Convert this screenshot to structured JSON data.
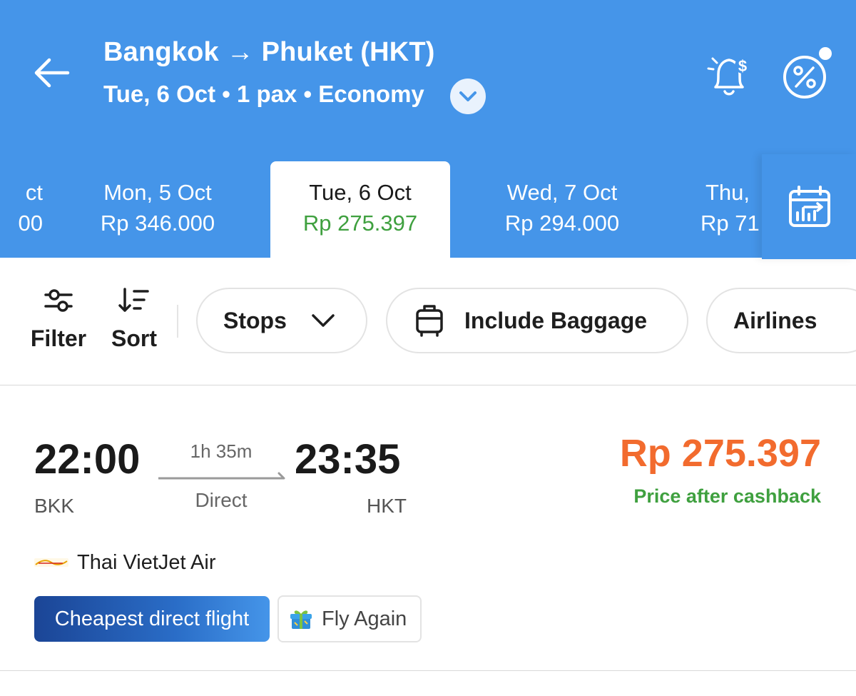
{
  "header": {
    "route_title": "Bangkok → Phuket (HKT)",
    "trip_summary": "Tue, 6 Oct • 1 pax • Economy",
    "icons": [
      "back-arrow-icon",
      "chevron-down-icon",
      "price-alert-bell-icon",
      "promo-percent-icon",
      "calendar-chart-icon"
    ]
  },
  "date_strip": {
    "partial_left": {
      "date": "ct",
      "price": "00"
    },
    "tabs": [
      {
        "date": "Mon, 5 Oct",
        "price": "Rp 346.000"
      },
      {
        "date": "Tue, 6 Oct",
        "price": "Rp 275.397",
        "selected": true
      },
      {
        "date": "Wed, 7 Oct",
        "price": "Rp 294.000"
      }
    ],
    "partial_right": {
      "date": "Thu,",
      "price": "Rp 71"
    }
  },
  "filters": {
    "filter_label": "Filter",
    "sort_label": "Sort",
    "chips": {
      "stops": "Stops",
      "baggage": "Include Baggage",
      "airlines": "Airlines"
    }
  },
  "flight": {
    "departure_time": "22:00",
    "departure_code": "BKK",
    "arrival_time": "23:35",
    "arrival_code": "HKT",
    "duration": "1h 35m",
    "stops": "Direct",
    "price": "Rp 275.397",
    "price_note": "Price after cashback",
    "airline": "Thai VietJet Air",
    "badges": {
      "cheapest": "Cheapest direct flight",
      "fly_again": "Fly Again"
    }
  },
  "colors": {
    "header_blue": "#4595e9",
    "price_orange": "#f26b2e",
    "green": "#3fa03f",
    "badge_blue": "#1b4596"
  }
}
